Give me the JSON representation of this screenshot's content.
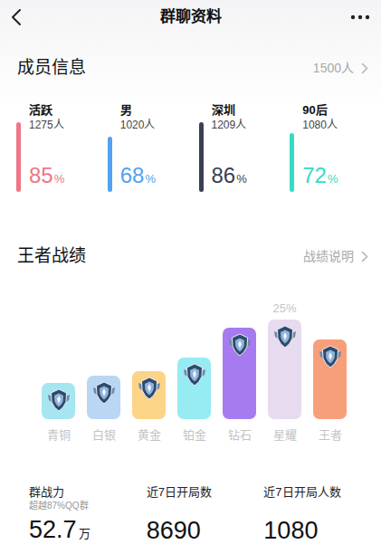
{
  "header": {
    "title": "群聊资料"
  },
  "members": {
    "title": "成员信息",
    "total": "1500人",
    "stats": [
      {
        "label": "活跃",
        "count": "1275人",
        "value": "85",
        "unit": "%",
        "level": 0.85,
        "color": "#ee7686"
      },
      {
        "label": "男",
        "count": "1020人",
        "value": "68",
        "unit": "%",
        "level": 0.68,
        "color": "#52a2f0"
      },
      {
        "label": "深圳",
        "count": "1209人",
        "value": "86",
        "unit": "%",
        "level": 0.86,
        "color": "#3a3f54"
      },
      {
        "label": "90后",
        "count": "1080人",
        "value": "72",
        "unit": "%",
        "level": 0.72,
        "color": "#33dcc3"
      }
    ]
  },
  "battle": {
    "title": "王者战绩",
    "link": "战绩说明",
    "chart": {
      "unit": "%",
      "values": [
        9,
        11,
        12,
        15.5,
        23,
        25,
        20
      ],
      "callout": "25%",
      "bars": [
        {
          "label": "青铜",
          "color": "#a6e6f0",
          "selected": false
        },
        {
          "label": "白银",
          "color": "#b9d7f4",
          "selected": false
        },
        {
          "label": "黄金",
          "color": "#fcd488",
          "selected": false
        },
        {
          "label": "铂金",
          "color": "#97ebf2",
          "selected": false
        },
        {
          "label": "钻石",
          "color": "#a67bf0",
          "selected": false
        },
        {
          "label": "星耀",
          "color": "#e6dbef",
          "selected": true
        },
        {
          "label": "王者",
          "color": "#f79f7a",
          "selected": false
        }
      ]
    }
  },
  "summary": [
    {
      "title": "群战力",
      "note": "超越87%QQ群",
      "value": "52.7",
      "unit": "万"
    },
    {
      "title": "近7日开局数",
      "value": "8690"
    },
    {
      "title": "近7日开局人数",
      "value": "1080"
    }
  ]
}
